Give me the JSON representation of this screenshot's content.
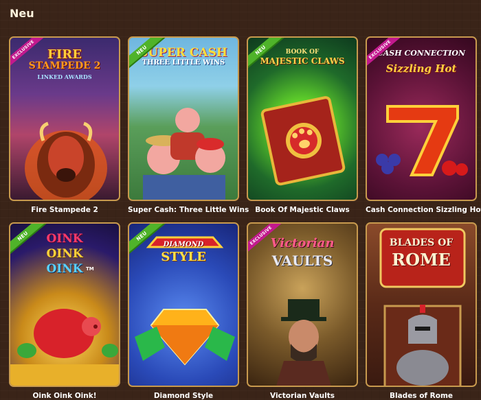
{
  "section": {
    "title": "Neu"
  },
  "games": [
    {
      "name": "Fire Stampede 2",
      "badge": "EXCLUSIVE",
      "logo_lines": [
        "FIRE",
        "STAMPEDE 2",
        "LINKED AWARDS"
      ]
    },
    {
      "name": "Super Cash: Three Little Wins",
      "badge": "NEU",
      "logo_lines": [
        "SUPER CASH",
        "THREE LITTLE WINS"
      ]
    },
    {
      "name": "Book Of Majestic Claws",
      "badge": "NEU",
      "logo_lines": [
        "BOOK OF",
        "MAJESTIC CLAWS"
      ]
    },
    {
      "name": "Cash Connection Sizzling Hot",
      "badge": "EXCLUSIVE",
      "logo_lines": [
        "CASH CONNECTION",
        "Sizzling Hot"
      ]
    },
    {
      "name": "Oink Oink Oink!",
      "badge": "NEU",
      "logo_lines": [
        "OINK",
        "OINK",
        "OINK",
        "TM"
      ]
    },
    {
      "name": "Diamond Style",
      "badge": "NEU",
      "logo_lines": [
        "DIAMOND",
        "STYLE"
      ]
    },
    {
      "name": "Victorian Vaults",
      "badge": "EXCLUSIVE",
      "logo_lines": [
        "Victorian",
        "VAULTS"
      ]
    },
    {
      "name": "Blades of Rome",
      "badge": "",
      "logo_lines": [
        "BLADES OF",
        "ROME"
      ]
    }
  ],
  "colors": {
    "background": "#3a2418",
    "card_border": "#c89a4e",
    "badge_new": "#4fb32a",
    "badge_exclusive": "#c2198d"
  }
}
